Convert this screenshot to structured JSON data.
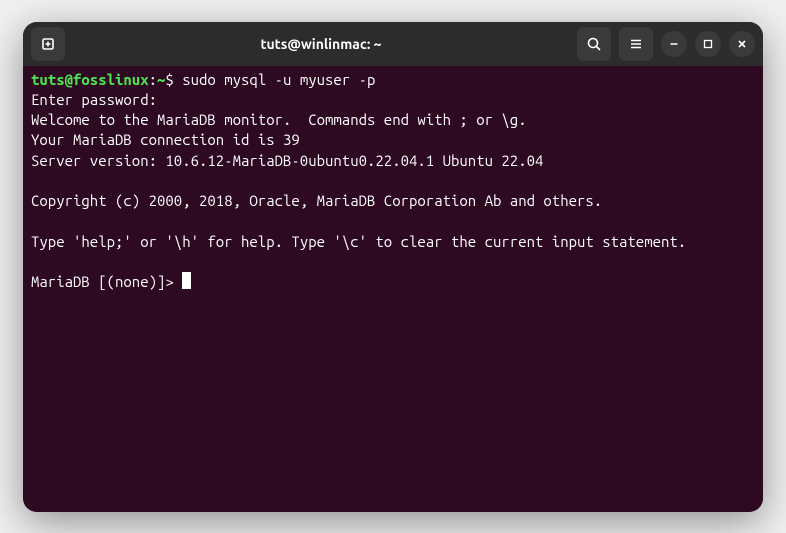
{
  "window": {
    "title": "tuts@winlinmac: ~"
  },
  "terminal": {
    "prompt_user": "tuts@fosslinux",
    "prompt_sep": ":",
    "prompt_path": "~",
    "prompt_dollar": "$ ",
    "command": "sudo mysql -u myuser -p",
    "lines": [
      "Enter password:",
      "Welcome to the MariaDB monitor.  Commands end with ; or \\g.",
      "Your MariaDB connection id is 39",
      "Server version: 10.6.12-MariaDB-0ubuntu0.22.04.1 Ubuntu 22.04",
      "",
      "Copyright (c) 2000, 2018, Oracle, MariaDB Corporation Ab and others.",
      "",
      "Type 'help;' or '\\h' for help. Type '\\c' to clear the current input statement.",
      ""
    ],
    "db_prompt": "MariaDB [(none)]> "
  }
}
